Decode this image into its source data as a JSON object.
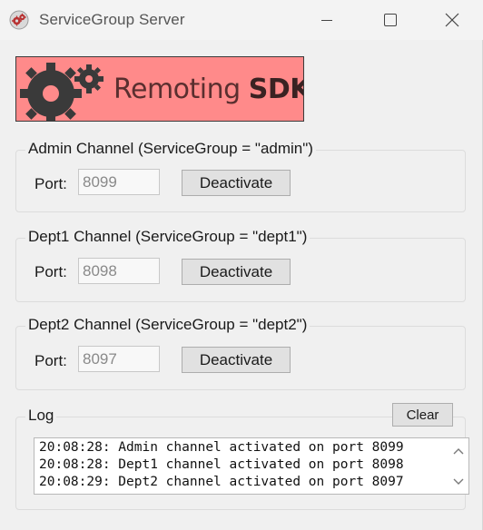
{
  "window": {
    "title": "ServiceGroup Server"
  },
  "logo": {
    "text_regular": "Remoting ",
    "text_bold": "SDK",
    "colors": {
      "background": "#ff8a8a",
      "gear": "#3a3a3a"
    }
  },
  "channels": [
    {
      "title": "Admin Channel (ServiceGroup = \"admin\")",
      "port_label": "Port:",
      "port_value": "8099",
      "button_label": "Deactivate"
    },
    {
      "title": "Dept1 Channel (ServiceGroup = \"dept1\")",
      "port_label": "Port:",
      "port_value": "8098",
      "button_label": "Deactivate"
    },
    {
      "title": "Dept2 Channel (ServiceGroup = \"dept2\")",
      "port_label": "Port:",
      "port_value": "8097",
      "button_label": "Deactivate"
    }
  ],
  "log": {
    "title": "Log",
    "clear_label": "Clear",
    "lines": [
      "20:08:28: Admin channel activated on port 8099",
      "20:08:28: Dept1 channel activated on port 8098",
      "20:08:29: Dept2 channel activated on port 8097"
    ]
  },
  "icons": {
    "app": "gears-icon",
    "minimize": "minimize-icon",
    "maximize": "maximize-icon",
    "close": "close-icon",
    "scroll_up": "chevron-up-icon",
    "scroll_down": "chevron-down-icon"
  }
}
